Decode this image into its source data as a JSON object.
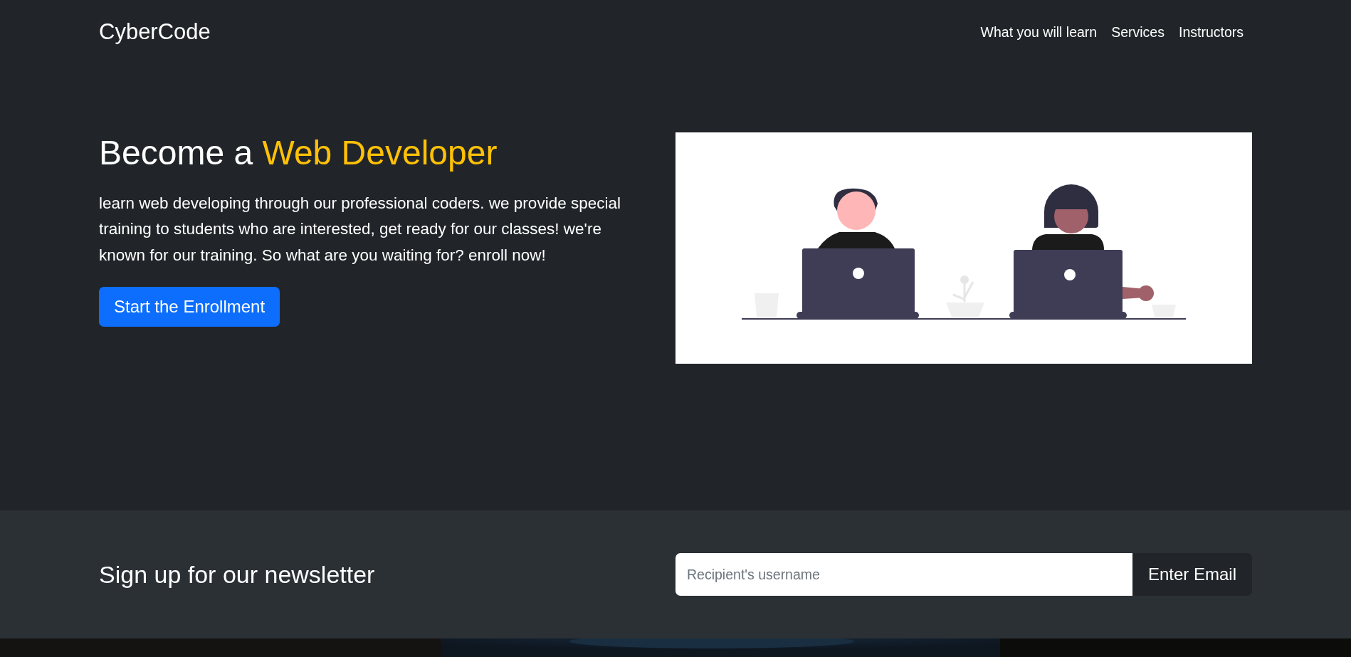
{
  "navbar": {
    "brand": "CyberCode",
    "links": [
      "What you will learn",
      "Services",
      "Instructors"
    ]
  },
  "hero": {
    "title": "Become a",
    "title_highlight": "Web Developer",
    "text": "learn web developing through our professional coders. we provide special training to students who are interested, get ready for our classes! we're known for our training. So what are you waiting for? enroll now!",
    "button": "Start the Enrollment"
  },
  "newsletter": {
    "title": "Sign up for our newsletter",
    "placeholder": "Recipient's username",
    "button": "Enter Email"
  }
}
